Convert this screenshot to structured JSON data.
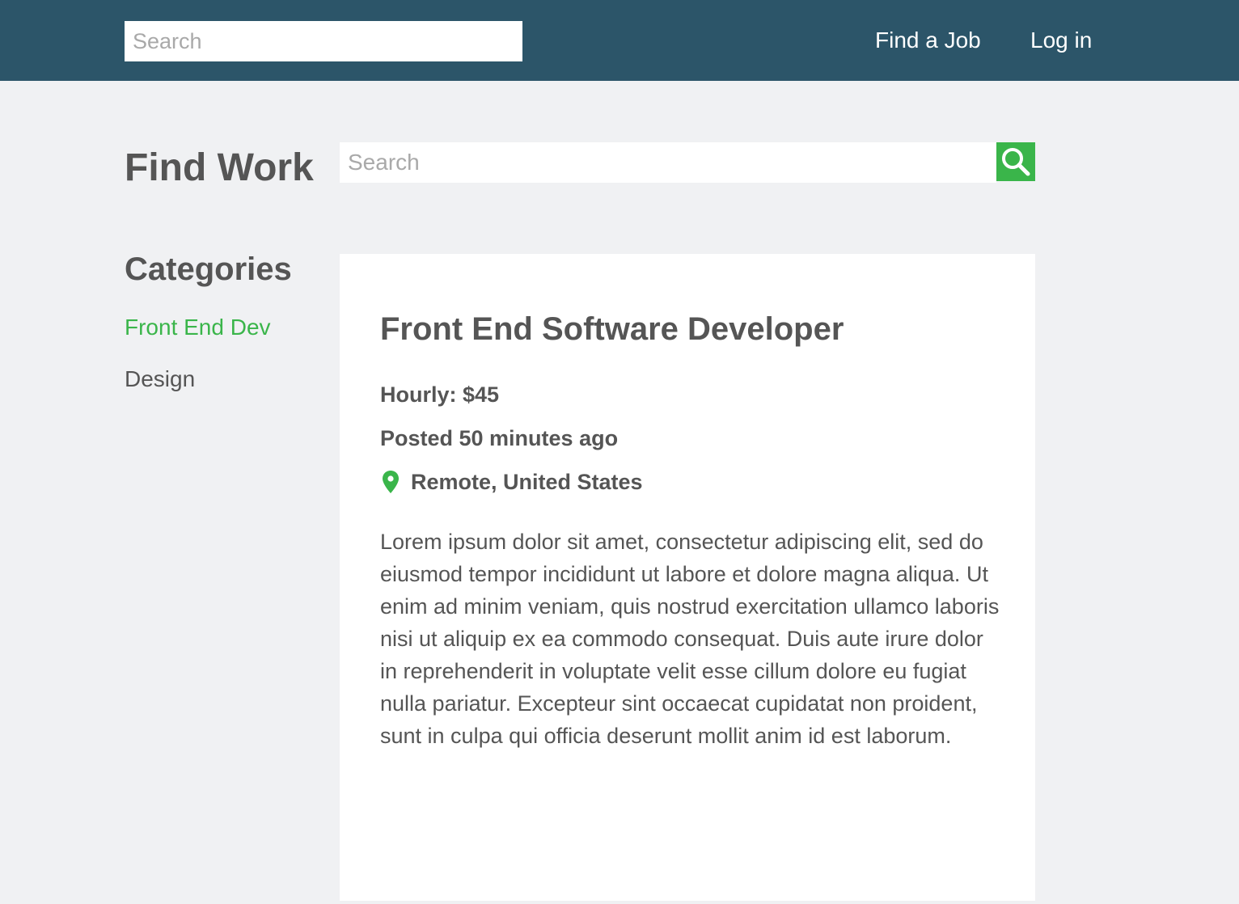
{
  "header": {
    "search_placeholder": "Search",
    "nav": {
      "find_job": "Find a Job",
      "login": "Log in"
    }
  },
  "main": {
    "title": "Find Work",
    "search_placeholder": "Search",
    "search_icon": "search-icon"
  },
  "categories": {
    "title": "Categories",
    "items": [
      {
        "label": "Front End Dev",
        "active": true
      },
      {
        "label": "Design",
        "active": false
      }
    ]
  },
  "job": {
    "title": "Front End Software Developer",
    "hourly": "Hourly: $45",
    "posted": "Posted 50 minutes ago",
    "location": "Remote, United States",
    "location_icon": "map-pin-icon",
    "description": "Lorem ipsum dolor sit amet, consectetur adipiscing elit, sed do eiusmod tempor incididunt ut labore et dolore magna aliqua. Ut enim ad minim veniam, quis nostrud exercitation ullamco laboris nisi ut aliquip ex ea commodo consequat. Duis aute irure dolor in reprehenderit in voluptate velit esse cillum dolore eu fugiat nulla pariatur. Excepteur sint occaecat cupidatat non proident, sunt in culpa qui officia deserunt mollit anim id est laborum."
  },
  "colors": {
    "header_bg": "#2c5569",
    "accent": "#3ab54a",
    "page_bg": "#f0f1f3",
    "text": "#555555"
  }
}
